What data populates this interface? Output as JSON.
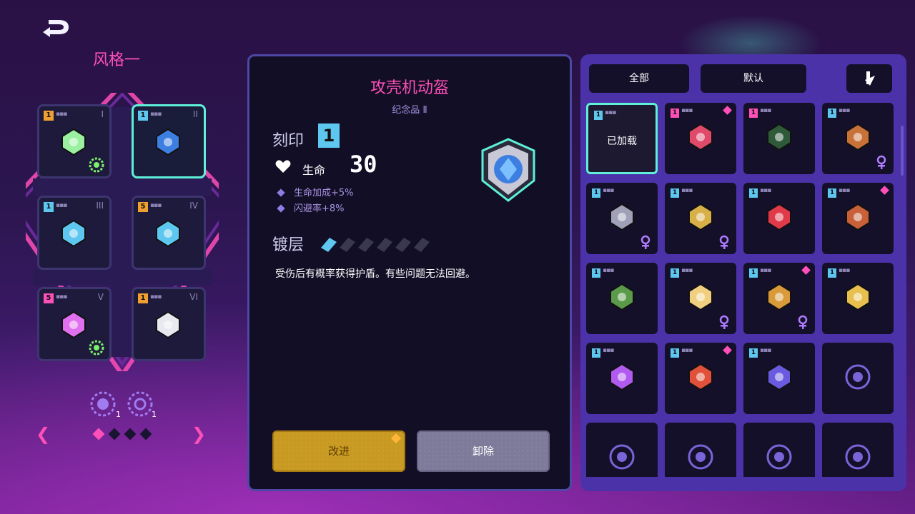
{
  "header": {
    "style_title": "风格一"
  },
  "loadout": {
    "slots": [
      {
        "roman": "I",
        "level": "1",
        "level_color": "#f0a030",
        "icon": "sprout-icon",
        "badge": "skull-gear-icon"
      },
      {
        "roman": "II",
        "level": "1",
        "level_color": "#5ec7f0",
        "icon": "shield-icon",
        "badge": ""
      },
      {
        "roman": "III",
        "level": "1",
        "level_color": "#5ec7f0",
        "icon": "chip-icon",
        "badge": ""
      },
      {
        "roman": "IV",
        "level": "5",
        "level_color": "#f0a030",
        "icon": "ring-icon",
        "badge": ""
      },
      {
        "roman": "V",
        "level": "5",
        "level_color": "#ff4fb8",
        "icon": "goggles-icon",
        "badge": "gear-icon"
      },
      {
        "roman": "VI",
        "level": "1",
        "level_color": "#f0a030",
        "icon": "horse-mask-icon",
        "badge": ""
      }
    ],
    "cores": [
      {
        "icon": "skull-core-icon",
        "count": "1"
      },
      {
        "icon": "gear-core-icon",
        "count": "1"
      }
    ],
    "page_count": 4,
    "page_current": 1
  },
  "detail": {
    "name": "攻壳机动盔",
    "category": "纪念品 Ⅱ",
    "inscription_label": "刻印",
    "inscription_level": "1",
    "hp_label": "生命",
    "hp_value": "30",
    "bonuses": [
      "生命加成+5%",
      "闪避率+8%"
    ],
    "coating_label": "镀层",
    "coating_level": 1,
    "coating_max": 6,
    "description": "受伤后有概率获得护盾。有些问题无法回避。",
    "upgrade_label": "改进",
    "remove_label": "卸除"
  },
  "inventory": {
    "filter_all": "全部",
    "filter_default": "默认",
    "sort_icon": "sort-icon",
    "equipped_label": "已加载",
    "items": [
      {
        "level": "1",
        "level_color": "#5ec7f0",
        "icon": "shield-icon",
        "equipped": true,
        "new": false,
        "tag": ""
      },
      {
        "level": "1",
        "level_color": "#ff4fb8",
        "icon": "target-icon",
        "equipped": false,
        "new": true,
        "tag": ""
      },
      {
        "level": "1",
        "level_color": "#ff4fb8",
        "icon": "hood-icon",
        "equipped": false,
        "new": false,
        "tag": ""
      },
      {
        "level": "1",
        "level_color": "#5ec7f0",
        "icon": "bag-icon",
        "equipped": false,
        "new": false,
        "tag": "ankh-icon"
      },
      {
        "level": "1",
        "level_color": "#5ec7f0",
        "icon": "microphone-icon",
        "equipped": false,
        "new": false,
        "tag": "bunny-icon"
      },
      {
        "level": "1",
        "level_color": "#5ec7f0",
        "icon": "horned-helmet-icon",
        "equipped": false,
        "new": false,
        "tag": "moon-icon"
      },
      {
        "level": "1",
        "level_color": "#5ec7f0",
        "icon": "red-gem-icon",
        "equipped": false,
        "new": false,
        "tag": ""
      },
      {
        "level": "1",
        "level_color": "#5ec7f0",
        "icon": "witch-hat-icon",
        "equipped": false,
        "new": true,
        "tag": ""
      },
      {
        "level": "1",
        "level_color": "#5ec7f0",
        "icon": "frog-icon",
        "equipped": false,
        "new": false,
        "tag": ""
      },
      {
        "level": "1",
        "level_color": "#5ec7f0",
        "icon": "bowl-icon",
        "equipped": false,
        "new": false,
        "tag": "ankh-icon"
      },
      {
        "level": "1",
        "level_color": "#5ec7f0",
        "icon": "tribal-mask-icon",
        "equipped": false,
        "new": true,
        "tag": "potion-icon"
      },
      {
        "level": "1",
        "level_color": "#5ec7f0",
        "icon": "crown-icon",
        "equipped": false,
        "new": false,
        "tag": ""
      },
      {
        "level": "1",
        "level_color": "#5ec7f0",
        "icon": "egg-icon",
        "equipped": false,
        "new": false,
        "tag": ""
      },
      {
        "level": "1",
        "level_color": "#5ec7f0",
        "icon": "drumstick-icon",
        "equipped": false,
        "new": true,
        "tag": ""
      },
      {
        "level": "1",
        "level_color": "#5ec7f0",
        "icon": "knight-helm-icon",
        "equipped": false,
        "new": false,
        "tag": ""
      },
      {
        "level": "",
        "level_color": "",
        "icon": "locked-heart-icon",
        "equipped": false,
        "new": false,
        "tag": ""
      },
      {
        "level": "",
        "level_color": "",
        "icon": "locked-orb-icon",
        "equipped": false,
        "new": false,
        "tag": ""
      },
      {
        "level": "",
        "level_color": "",
        "icon": "locked-head-icon",
        "equipped": false,
        "new": false,
        "tag": ""
      },
      {
        "level": "",
        "level_color": "",
        "icon": "locked-face-icon",
        "equipped": false,
        "new": false,
        "tag": ""
      },
      {
        "level": "",
        "level_color": "",
        "icon": "locked-skull-icon",
        "equipped": false,
        "new": false,
        "tag": ""
      }
    ]
  }
}
